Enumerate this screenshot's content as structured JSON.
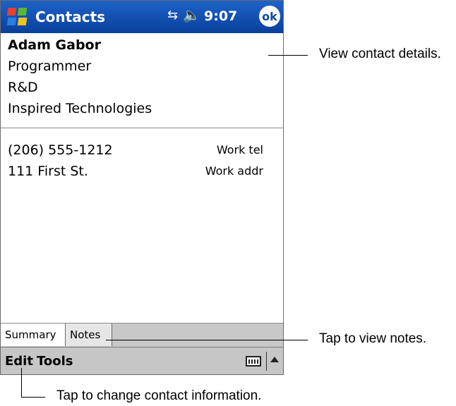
{
  "titlebar": {
    "app_title": "Contacts",
    "time": "9:07",
    "ok_label": "ok",
    "icons": [
      "windows-start-icon",
      "connectivity-icon",
      "volume-icon"
    ]
  },
  "contact": {
    "name": "Adam Gabor",
    "title": "Programmer",
    "department": "R&D",
    "company": "Inspired Technologies",
    "details": [
      {
        "value": "(206) 555-1212",
        "label": "Work tel"
      },
      {
        "value": "111 First St.",
        "label": "Work addr"
      }
    ]
  },
  "tabs": [
    {
      "label": "Summary"
    },
    {
      "label": "Notes"
    }
  ],
  "menubar": {
    "edit_label": "Edit",
    "tools_label": "Tools",
    "icons": [
      "keyboard-icon",
      "arrow-up-icon"
    ]
  },
  "callouts": {
    "details": "View contact details.",
    "notes": "Tap to view notes.",
    "edit": "Tap to change contact information."
  },
  "colors": {
    "titlebar": "#0a3f9a",
    "menubar": "#c6c6c6"
  }
}
